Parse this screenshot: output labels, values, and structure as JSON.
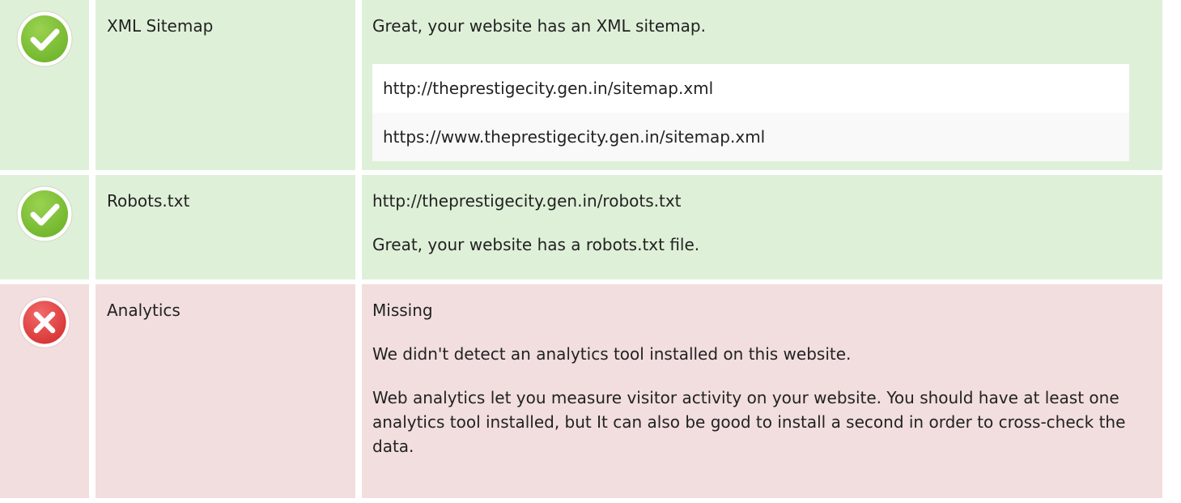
{
  "colors": {
    "pass_bg": "#dff0d8",
    "fail_bg": "#f2dede",
    "pass_icon": "#7ec13a",
    "fail_icon": "#e04343"
  },
  "rows": [
    {
      "status": "pass",
      "icon": "check-circle-icon",
      "name": "XML Sitemap",
      "detail": {
        "message": "Great, your website has an XML sitemap.",
        "urls": [
          "http://theprestigecity.gen.in/sitemap.xml",
          "https://www.theprestigecity.gen.in/sitemap.xml"
        ]
      }
    },
    {
      "status": "pass",
      "icon": "check-circle-icon",
      "name": "Robots.txt",
      "detail": {
        "url": "http://theprestigecity.gen.in/robots.txt",
        "message": "Great, your website has a robots.txt file."
      }
    },
    {
      "status": "fail",
      "icon": "error-circle-icon",
      "name": "Analytics",
      "detail": {
        "status_text": "Missing",
        "message": "We didn't detect an analytics tool installed on this website.",
        "advice": "Web analytics let you measure visitor activity on your website. You should have at least one analytics tool installed, but It can also be good to install a second in order to cross-check the data."
      }
    }
  ]
}
